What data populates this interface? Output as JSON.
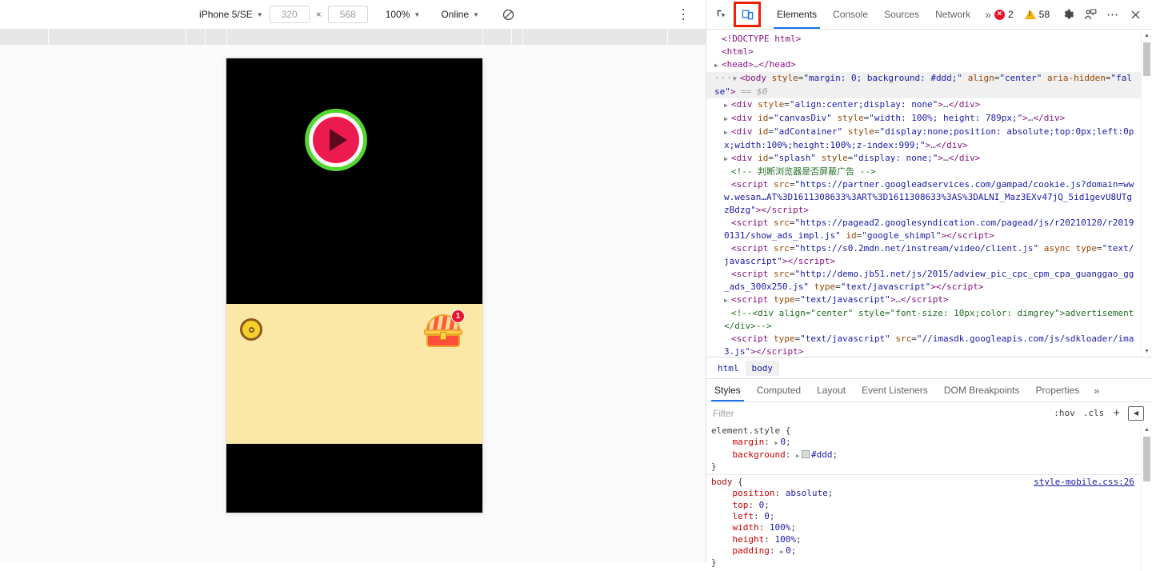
{
  "device_toolbar": {
    "device_name": "iPhone 5/SE",
    "width": "320",
    "height": "568",
    "zoom": "100%",
    "network": "Online",
    "throttle_icon": "no-throttling-icon",
    "more_icon": "vertical-dots-icon"
  },
  "phone_screen": {
    "play_button_icon": "play-triangle-icon",
    "coin_icon": "coin-icon",
    "chest_icon": "treasure-chest-icon",
    "chest_badge": "1"
  },
  "devtools": {
    "inspect_icon": "inspect-element-icon",
    "device_toggle_icon": "toggle-device-toolbar-icon",
    "tabs": [
      {
        "label": "Elements",
        "active": true
      },
      {
        "label": "Console",
        "active": false
      },
      {
        "label": "Sources",
        "active": false
      },
      {
        "label": "Network",
        "active": false
      }
    ],
    "more_tabs_icon": "chevron-double-right-icon",
    "error_count": "2",
    "warning_count": "58",
    "settings_icon": "gear-icon",
    "feedback_icon": "user-feedback-icon",
    "menu_icon": "horizontal-dots-icon",
    "close_icon": "close-icon"
  },
  "dom_tree": {
    "nodes": [
      {
        "indent": 0,
        "arrow": "",
        "html": "<span class=\"tg\">&lt;!DOCTYPE html&gt;</span>"
      },
      {
        "indent": 0,
        "arrow": "",
        "html": "<span class=\"tg\">&lt;html&gt;</span>"
      },
      {
        "indent": 0,
        "arrow": "collapsed",
        "html": "<span class=\"tg\">&lt;head&gt;</span><span class=\"pn\">…</span><span class=\"tg\">&lt;/head&gt;</span>"
      },
      {
        "indent": 0,
        "arrow": "expanded",
        "selected": true,
        "dots": true,
        "html": "<span class=\"tg\">&lt;body</span> <span class=\"at\">style</span>=<span class=\"av\">\"margin: 0; background: #ddd;\"</span> <span class=\"at\">align</span>=<span class=\"av\">\"center\"</span> <span class=\"at\">aria-hidden</span>=<span class=\"av\">\"false\"</span><span class=\"tg\">&gt;</span> <span class=\"dollar\">== $0</span>"
      },
      {
        "indent": 1,
        "arrow": "collapsed",
        "html": "<span class=\"tg\">&lt;div</span> <span class=\"at\">style</span>=<span class=\"av\">\"align:center;display: none\"</span><span class=\"tg\">&gt;</span><span class=\"pn\">…</span><span class=\"tg\">&lt;/div&gt;</span>"
      },
      {
        "indent": 1,
        "arrow": "collapsed",
        "html": "<span class=\"tg\">&lt;div</span> <span class=\"at\">id</span>=<span class=\"av\">\"canvasDiv\"</span> <span class=\"at\">style</span>=<span class=\"av\">\"width: 100%; height: 789px;\"</span><span class=\"tg\">&gt;</span><span class=\"pn\">…</span><span class=\"tg\">&lt;/div&gt;</span>"
      },
      {
        "indent": 1,
        "arrow": "collapsed",
        "html": "<span class=\"tg\">&lt;div</span> <span class=\"at\">id</span>=<span class=\"av\">\"adContainer\"</span> <span class=\"at\">style</span>=<span class=\"av\">\"display:none;position: absolute;top:0px;left:0px;width:100%;height:100%;z-index:999;\"</span><span class=\"tg\">&gt;</span><span class=\"pn\">…</span><span class=\"tg\">&lt;/div&gt;</span>"
      },
      {
        "indent": 1,
        "arrow": "collapsed",
        "html": "<span class=\"tg\">&lt;div</span> <span class=\"at\">id</span>=<span class=\"av\">\"splash\"</span> <span class=\"at\">style</span>=<span class=\"av\">\"display: none;\"</span><span class=\"tg\">&gt;</span><span class=\"pn\">…</span><span class=\"tg\">&lt;/div&gt;</span>"
      },
      {
        "indent": 1,
        "arrow": "",
        "html": "<span class=\"cmt\">&lt;!-- 判断浏览器是否屏蔽广告 --&gt;</span>"
      },
      {
        "indent": 1,
        "arrow": "",
        "html": "<span class=\"tg\">&lt;script</span> <span class=\"at\">src</span>=<span class=\"av\">\"https://partner.googleadservices.com/gampad/cookie.js?domain=www.wesan…AT%3D1611308633%3ART%3D1611308633%3AS%3DALNI_Maz3EXv47jQ_5id1gevU8UTgzBdzg\"</span><span class=\"tg\">&gt;&lt;/script&gt;</span>"
      },
      {
        "indent": 1,
        "arrow": "",
        "html": "<span class=\"tg\">&lt;script</span> <span class=\"at\">src</span>=<span class=\"av\">\"https://pagead2.googlesyndication.com/pagead/js/r20210120/r20190131/show_ads_impl.js\"</span> <span class=\"at\">id</span>=<span class=\"av\">\"google_shimpl\"</span><span class=\"tg\">&gt;&lt;/script&gt;</span>"
      },
      {
        "indent": 1,
        "arrow": "",
        "html": "<span class=\"tg\">&lt;script</span> <span class=\"at\">src</span>=<span class=\"av\">\"https://s0.2mdn.net/instream/video/client.js\"</span> <span class=\"at\">async</span> <span class=\"at\">type</span>=<span class=\"av\">\"text/javascript\"</span><span class=\"tg\">&gt;&lt;/script&gt;</span>"
      },
      {
        "indent": 1,
        "arrow": "",
        "html": "<span class=\"tg\">&lt;script</span> <span class=\"at\">src</span>=<span class=\"av\">\"http://demo.jb51.net/js/2015/adview_pic_cpc_cpm_cpa_guanggao_gg_ads_300x250.js\"</span> <span class=\"at\">type</span>=<span class=\"av\">\"text/javascript\"</span><span class=\"tg\">&gt;&lt;/script&gt;</span>"
      },
      {
        "indent": 1,
        "arrow": "collapsed",
        "html": "<span class=\"tg\">&lt;script</span> <span class=\"at\">type</span>=<span class=\"av\">\"text/javascript\"</span><span class=\"tg\">&gt;</span><span class=\"pn\">…</span><span class=\"tg\">&lt;/script&gt;</span>"
      },
      {
        "indent": 1,
        "arrow": "",
        "html": "<span class=\"cmt\">&lt;!--&lt;div align=\"center\" style=\"font-size: 10px;color: dimgrey\"&gt;advertisement&lt;/div&gt;--&gt;</span>"
      },
      {
        "indent": 1,
        "arrow": "",
        "html": "<span class=\"tg\">&lt;script</span> <span class=\"at\">type</span>=<span class=\"av\">\"text/javascript\"</span> <span class=\"at\">src</span>=<span class=\"av\">\"//imasdk.googleapis.com/js/sdkloader/ima3.js\"</span><span class=\"tg\">&gt;&lt;/script&gt;</span>"
      }
    ]
  },
  "breadcrumb": {
    "items": [
      {
        "label": "html",
        "active": false
      },
      {
        "label": "body",
        "active": true
      }
    ]
  },
  "styles_panel": {
    "tabs": [
      {
        "label": "Styles",
        "active": true
      },
      {
        "label": "Computed",
        "active": false
      },
      {
        "label": "Layout",
        "active": false
      },
      {
        "label": "Event Listeners",
        "active": false
      },
      {
        "label": "DOM Breakpoints",
        "active": false
      },
      {
        "label": "Properties",
        "active": false
      }
    ],
    "more_tabs_icon": "chevron-double-right-icon",
    "filter_placeholder": "Filter",
    "filter_value": "",
    "hov_label": ":hov",
    "cls_label": ".cls",
    "add_rule_icon": "plus-icon",
    "sidebar_toggle_icon": "show-sidebar-icon",
    "rules": [
      {
        "selector": "element.style",
        "selector_kind": "element",
        "source": "",
        "declarations": [
          {
            "name": "margin",
            "value": "0",
            "disclosure": true,
            "swatch": false
          },
          {
            "name": "background",
            "value": "#ddd",
            "disclosure": true,
            "swatch": true
          }
        ]
      },
      {
        "selector": "body",
        "selector_kind": "rule",
        "source": "style-mobile.css:26",
        "declarations": [
          {
            "name": "position",
            "value": "absolute",
            "disclosure": false,
            "swatch": false
          },
          {
            "name": "top",
            "value": "0",
            "disclosure": false,
            "swatch": false
          },
          {
            "name": "left",
            "value": "0",
            "disclosure": false,
            "swatch": false
          },
          {
            "name": "width",
            "value": "100%",
            "disclosure": false,
            "swatch": false
          },
          {
            "name": "height",
            "value": "100%",
            "disclosure": false,
            "swatch": false
          },
          {
            "name": "padding",
            "value": "0",
            "disclosure": true,
            "swatch": false
          }
        ]
      }
    ]
  },
  "colors": {
    "accent": "#1a73e8",
    "highlight_box": "#f01f00",
    "error": "#e8152b",
    "warning": "#f5b400",
    "screen_yellow": "#fce8a6",
    "play_green": "#54d62c",
    "play_pink": "#ed1a4f"
  }
}
